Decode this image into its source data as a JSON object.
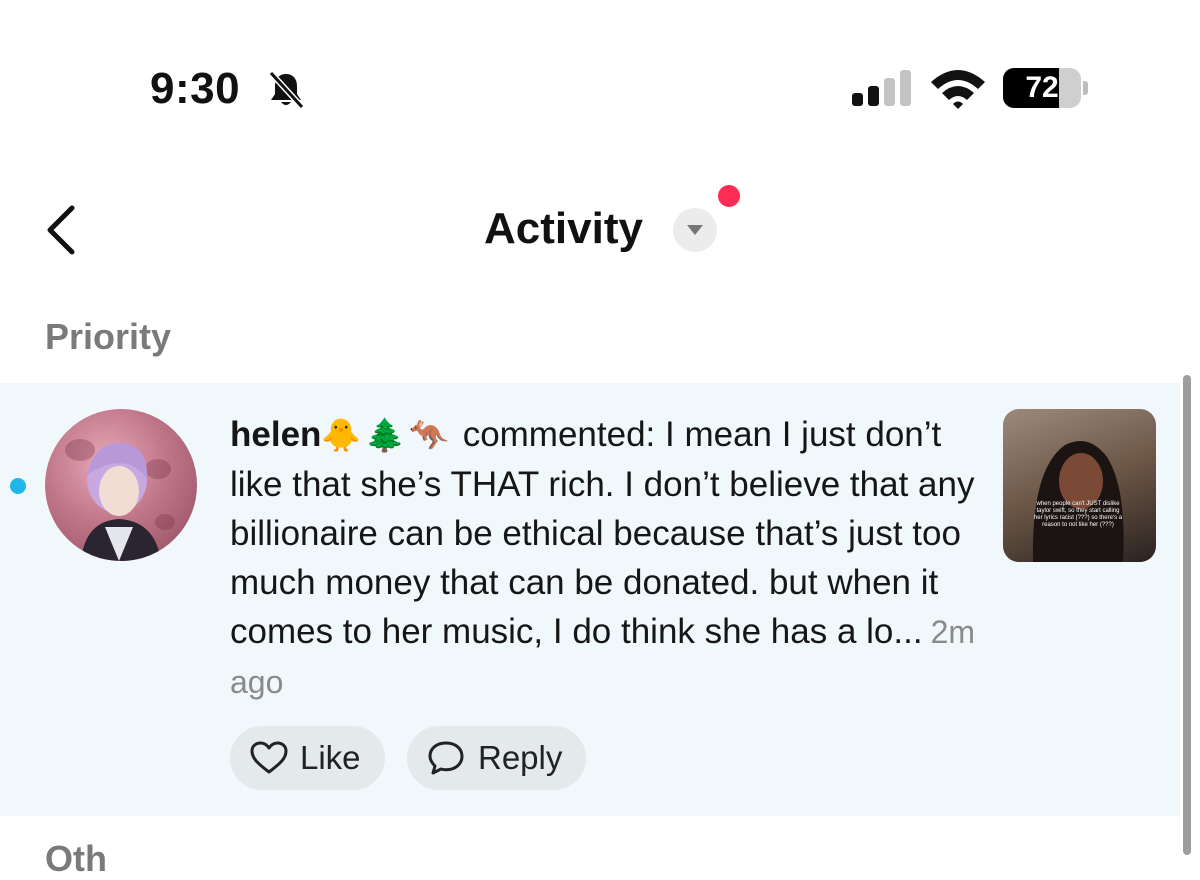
{
  "status_bar": {
    "time": "9:30",
    "battery_level": "72",
    "battery_percent": 72,
    "icons": [
      "bell-slash-icon",
      "signal-icon",
      "wifi-icon",
      "battery-icon"
    ]
  },
  "header": {
    "title": "Activity",
    "back_icon": "chevron-left-icon",
    "dropdown_icon": "caret-down-icon"
  },
  "section": {
    "label": "Priority",
    "next_label": "Oth"
  },
  "notification": {
    "username": "helen",
    "emojis": [
      "🐥",
      "🌲",
      "🦘"
    ],
    "comment": "commented: I mean I just don’t like that she’s THAT rich. I don’t believe that any billionaire can be ethical because that’s just too much money that can be donated. but when it comes to her music, I do think she has a lo...",
    "time_ago": "2m ago",
    "video_caption": "when people can't JUST dislike taylor swift, so they start calling her lyrics racist (???) so there's a reason to not like her (???)",
    "actions": {
      "like_label": "Like",
      "reply_label": "Reply"
    }
  },
  "colors": {
    "accent_red": "#fe2c55",
    "unread_dot": "#1fb6e8",
    "card_bg": "#f1f8fb",
    "pill_bg": "#e4e9eb"
  }
}
